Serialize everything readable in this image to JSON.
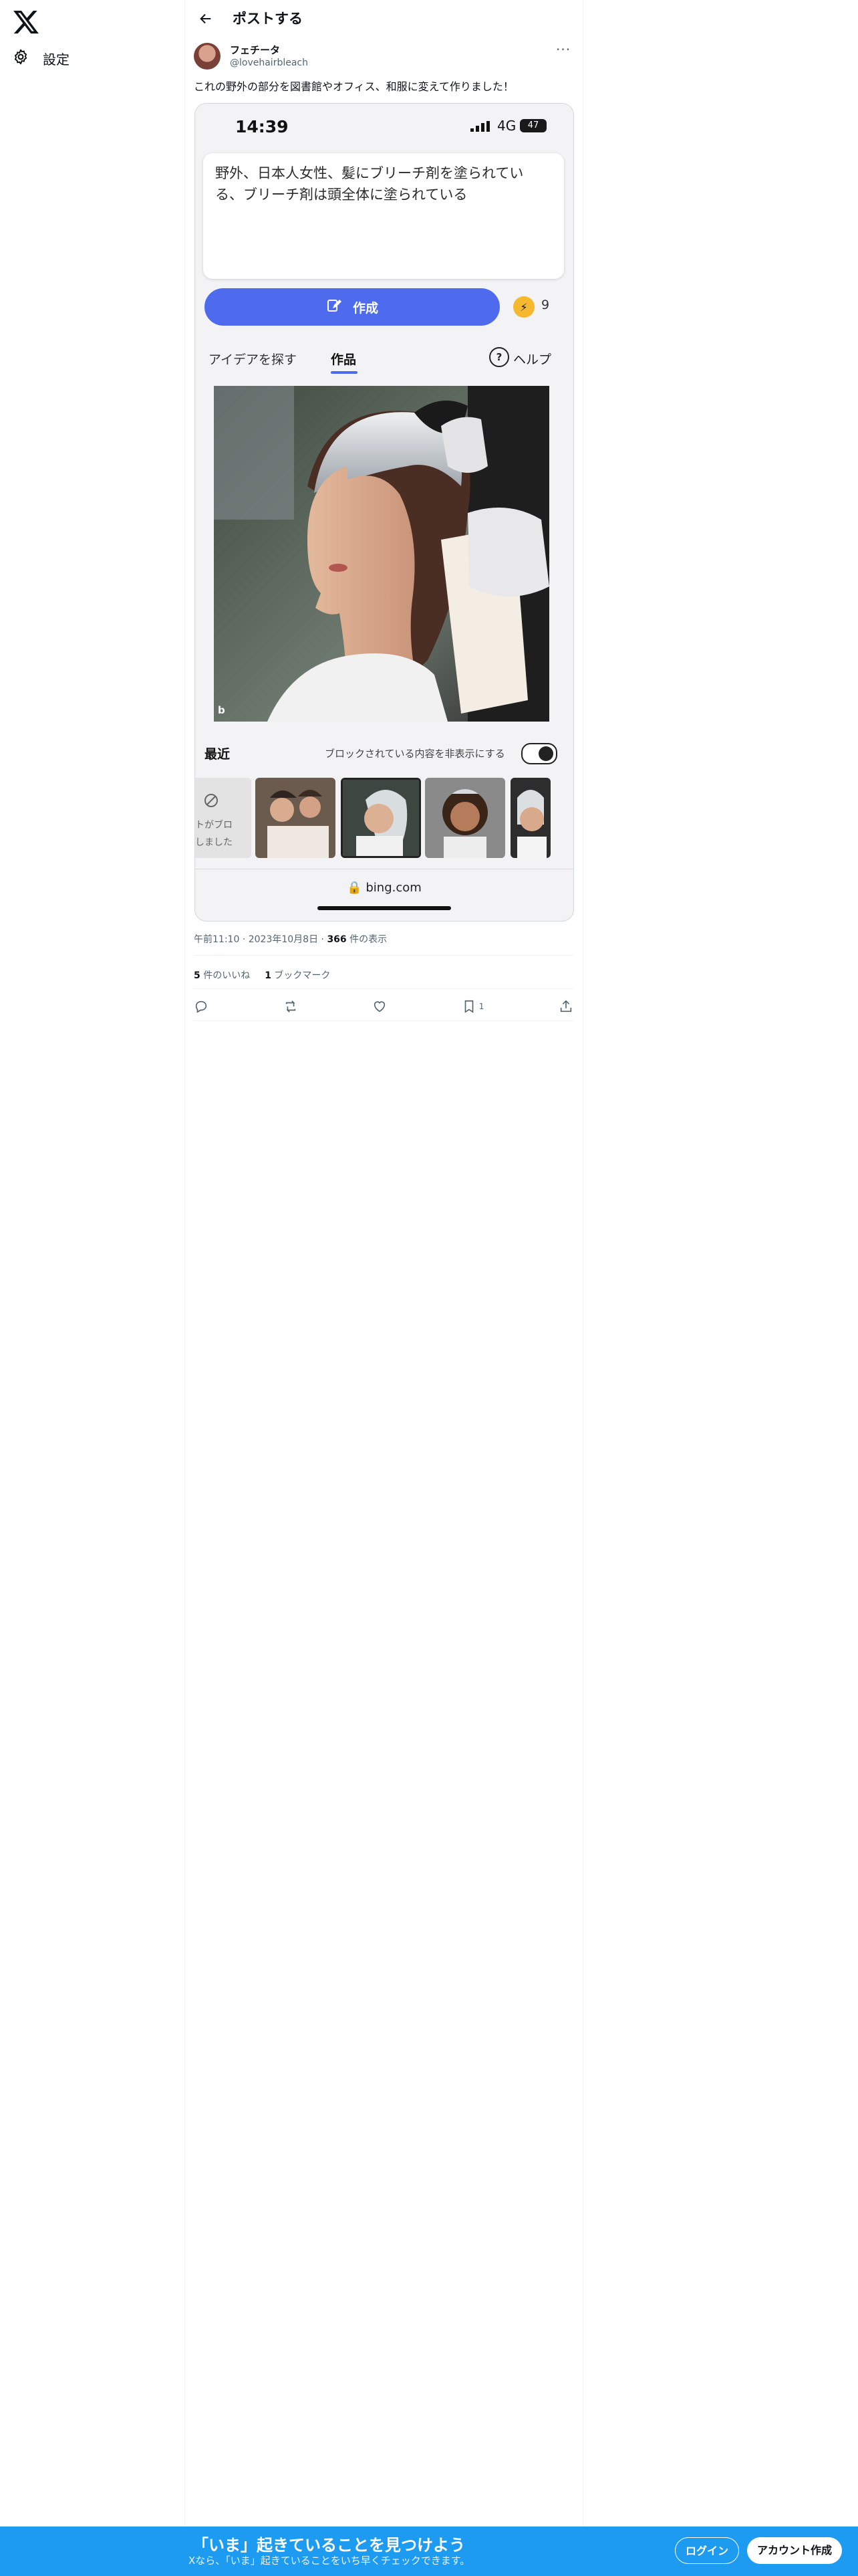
{
  "nav": {
    "settings_label": "設定"
  },
  "header": {
    "title": "ポストする"
  },
  "post": {
    "author_name": "フェチータ",
    "author_handle": "@lovehairbleach",
    "text": "これの野外の部分を図書館やオフィス、和服に変えて作りました！"
  },
  "phone": {
    "time": "14:39",
    "network": "4G",
    "battery": "47",
    "prompt": "野外、日本人女性、髪にブリーチ剤を塗られている、ブリーチ剤は頭全体に塗られている",
    "create_label": "作成",
    "boost_count": "9",
    "tab_explore": "アイデアを探す",
    "tab_creations": "作品",
    "help_label": "ヘルプ",
    "help_icon": "?",
    "image_mark": "b",
    "recent_label": "最近",
    "hide_blocked_label": "ブロックされている内容を非表示にする",
    "blocked_thumb_text": "トがブロ\nしました",
    "url": "bing.com"
  },
  "meta": {
    "time": "午前11:10",
    "date": "2023年10月8日",
    "views_count": "366",
    "views_label": "件の表示"
  },
  "stats": {
    "likes_count": "5",
    "likes_label": "件のいいね",
    "bookmarks_count": "1",
    "bookmarks_label": "ブックマーク"
  },
  "actions": {
    "bookmark_count": "1"
  },
  "banner": {
    "title": "「いま」起きていることを見つけよう",
    "subtitle": "Xなら、「いま」起きていることをいち早くチェックできます。",
    "login_label": "ログイン",
    "signup_label": "アカウント作成"
  },
  "colors": {
    "accent": "#1d9bf0",
    "bing_button": "#4f6bed",
    "text": "#0f1419",
    "muted": "#536471"
  }
}
